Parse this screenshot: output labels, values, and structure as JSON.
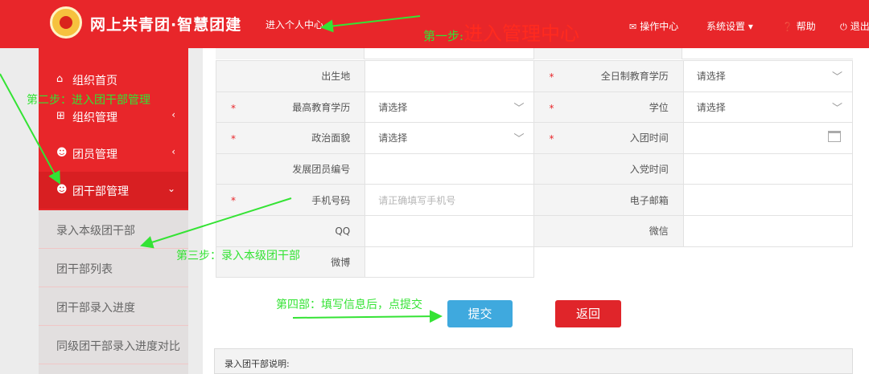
{
  "header": {
    "brand": "网上共青团·智慧团建",
    "personal_center": "进入个人中心",
    "nav": [
      {
        "label": "操作中心",
        "icon": "envelope-icon"
      },
      {
        "label": "系统设置 ▾",
        "icon": ""
      },
      {
        "label": "帮助",
        "icon": "help-icon"
      },
      {
        "label": "退出",
        "icon": "power-icon"
      }
    ]
  },
  "sidebar": {
    "items": [
      {
        "label": "组织首页",
        "icon": "home-icon",
        "caret": ""
      },
      {
        "label": "组织管理",
        "icon": "org-chart-icon",
        "caret": "‹"
      },
      {
        "label": "团员管理",
        "icon": "users-icon",
        "caret": "‹"
      },
      {
        "label": "团干部管理",
        "icon": "users-icon",
        "caret": "⌄"
      }
    ],
    "subitems": [
      "录入本级团干部",
      "团干部列表",
      "团干部录入进度",
      "同级团干部录入进度对比"
    ]
  },
  "form": {
    "rows": [
      {
        "l1": "出生地",
        "r1": false,
        "v1": "",
        "ph1": false,
        "s1": false,
        "l2": "全日制教育学历",
        "r2": true,
        "v2": "请选择",
        "s2": true
      },
      {
        "l1": "最高教育学历",
        "r1": true,
        "v1": "请选择",
        "ph1": false,
        "s1": true,
        "l2": "学位",
        "r2": true,
        "v2": "请选择",
        "s2": true
      },
      {
        "l1": "政治面貌",
        "r1": true,
        "v1": "请选择",
        "ph1": false,
        "s1": true,
        "l2": "入团时间",
        "r2": true,
        "v2": "",
        "s2": false,
        "cal": true
      },
      {
        "l1": "发展团员编号",
        "r1": false,
        "v1": "",
        "ph1": false,
        "s1": false,
        "l2": "入党时间",
        "r2": false,
        "v2": "",
        "s2": false
      },
      {
        "l1": "手机号码",
        "r1": true,
        "v1": "请正确填写手机号",
        "ph1": true,
        "s1": false,
        "l2": "电子邮箱",
        "r2": false,
        "v2": "",
        "s2": false
      },
      {
        "l1": "QQ",
        "r1": false,
        "v1": "",
        "ph1": false,
        "s1": false,
        "l2": "微信",
        "r2": false,
        "v2": "",
        "s2": false
      },
      {
        "l1": "微博",
        "r1": false,
        "v1": "",
        "ph1": false,
        "s1": false,
        "l2": "",
        "r2": false,
        "v2": "",
        "s2": false,
        "merged": true
      }
    ],
    "required_mark": "*",
    "submit": "提交",
    "back": "返回",
    "notes_title": "录入团干部说明:"
  },
  "annotations": {
    "step1_prefix": "第一步:",
    "step1_main": "进入管理中心",
    "step2": "第二步：进入团干部管理",
    "step3": "第三步：录入本级团干部",
    "step4": "第四部：填写信息后，点提交"
  },
  "colors": {
    "brand_red": "#e8262a",
    "submit_blue": "#3fa9de",
    "annotation_green": "#34e334",
    "annotation_red": "#ff2a1f"
  }
}
